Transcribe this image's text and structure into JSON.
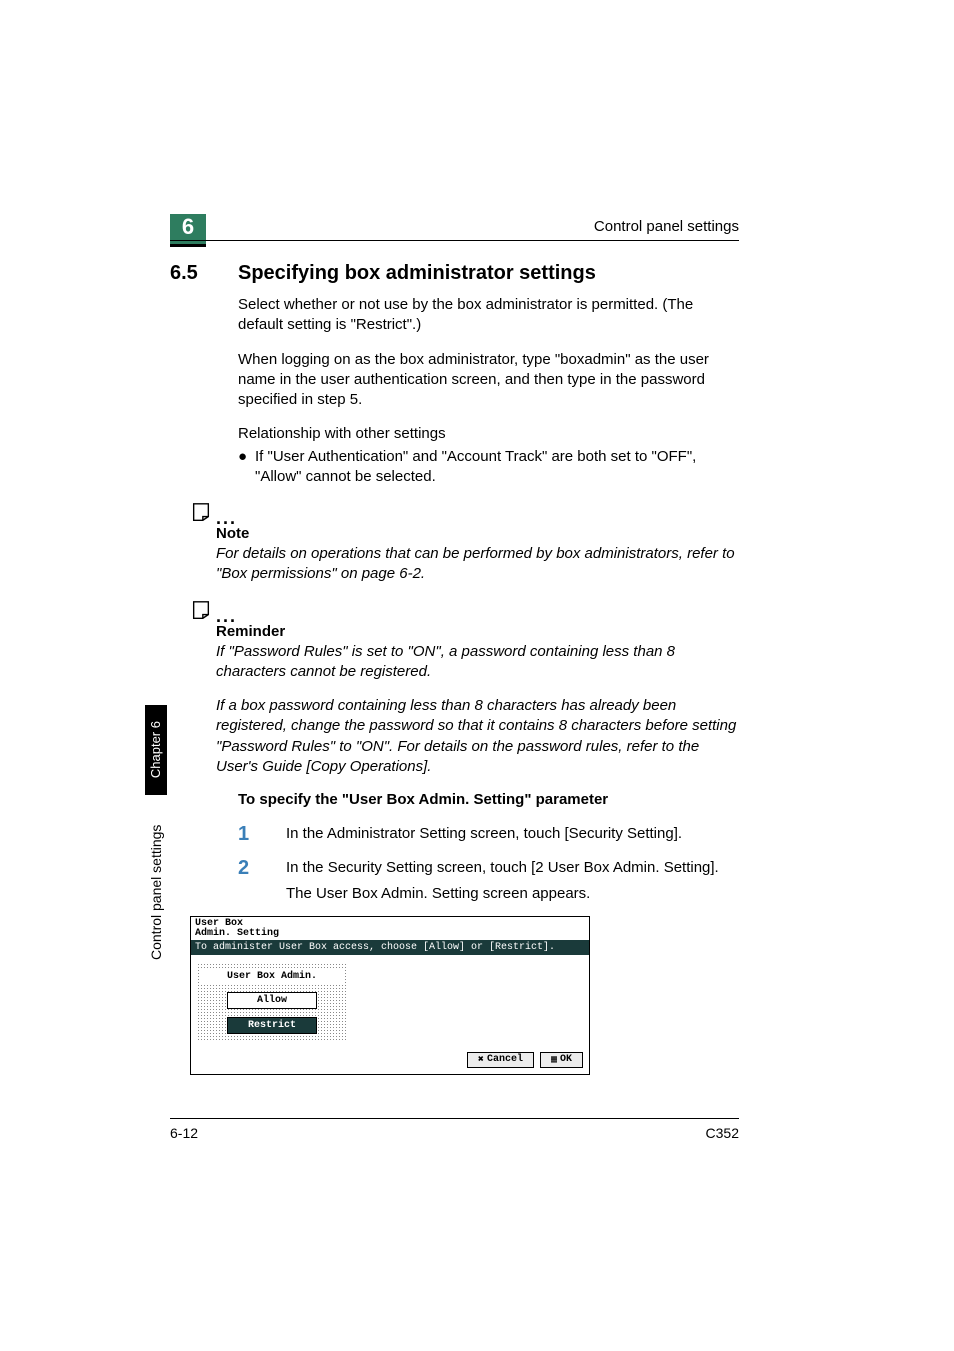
{
  "header": {
    "running_title": "Control panel settings",
    "chapter_number": "6"
  },
  "section": {
    "number": "6.5",
    "title": "Specifying box administrator settings"
  },
  "paragraphs": {
    "p1": "Select whether or not use by the box administrator is permitted. (The default setting is \"Restrict\".)",
    "p2": "When logging on as the box administrator, type \"boxadmin\" as the user name in the user authentication screen, and then type in the password specified in step 5.",
    "p3": "Relationship with other settings",
    "bullet1": "If \"User Authentication\" and \"Account Track\" are both set to \"OFF\", \"Allow\" cannot be selected."
  },
  "note": {
    "label": "Note",
    "body": "For details on operations that can be performed by box administrators, refer to \"Box permissions\" on page 6-2."
  },
  "reminder": {
    "label": "Reminder",
    "body1": "If \"Password Rules\" is set to \"ON\", a password containing less than 8 characters cannot be registered.",
    "body2": "If a box password containing less than 8 characters has already been registered, change the password so that it contains 8 characters before setting \"Password Rules\" to \"ON\". For details on the password rules, refer to the User's Guide [Copy Operations]."
  },
  "sub_heading": "To specify the \"User Box Admin. Setting\" parameter",
  "steps": {
    "s1_num": "1",
    "s1_text": "In the Administrator Setting screen, touch [Security Setting].",
    "s2_num": "2",
    "s2_text": "In the Security Setting screen, touch [2 User Box Admin. Setting].",
    "s2_sub": "The User Box Admin. Setting screen appears."
  },
  "screen": {
    "title_line1": "User Box",
    "title_line2": "Admin. Setting",
    "instruction": "To administer User Box access, choose [Allow] or [Restrict].",
    "panel_label": "User Box Admin.",
    "allow": "Allow",
    "restrict": "Restrict",
    "cancel": "Cancel",
    "ok": "OK"
  },
  "side": {
    "text": "Control panel settings",
    "chapter": "Chapter 6"
  },
  "footer": {
    "page": "6-12",
    "model": "C352"
  }
}
